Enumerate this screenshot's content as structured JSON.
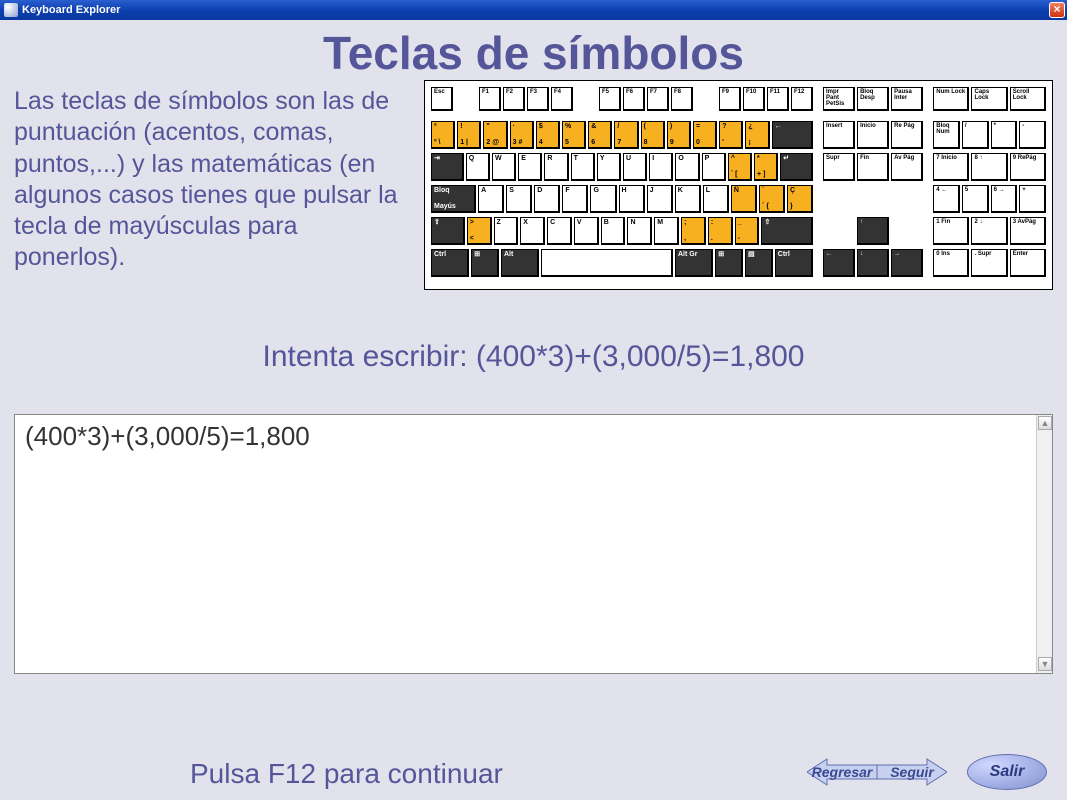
{
  "window": {
    "title": "Keyboard Explorer"
  },
  "page": {
    "heading": "Teclas de símbolos",
    "description": "Las teclas de símbolos son las de puntuación (acentos, comas, puntos,...) y las matemáticas (en algunos casos tienes que pulsar la tecla de mayúsculas para ponerlos).",
    "prompt": "Intenta escribir: (400*3)+(3,000/5)=1,800",
    "input_value": "(400*3)+(3,000/5)=1,800",
    "hint": "Pulsa F12 para continuar"
  },
  "buttons": {
    "back": "Regresar",
    "next": "Seguir",
    "exit": "Salir"
  },
  "keyboard": {
    "function_row": [
      "Esc",
      "F1",
      "F2",
      "F3",
      "F4",
      "F5",
      "F6",
      "F7",
      "F8",
      "F9",
      "F10",
      "F11",
      "F12"
    ],
    "indicators_top": [
      "Impr Pant PetSis",
      "Bloq Desp",
      "Pausa Inter"
    ],
    "leds": [
      "Num Lock",
      "Caps Lock",
      "Scroll Lock"
    ],
    "row1": [
      {
        "t": "ª",
        "b": "º \\",
        "y": true
      },
      {
        "t": "!",
        "b": "1 |",
        "y": true
      },
      {
        "t": "\"",
        "b": "2 @",
        "y": true
      },
      {
        "t": "·",
        "b": "3 #",
        "y": true
      },
      {
        "t": "$",
        "b": "4",
        "y": true
      },
      {
        "t": "%",
        "b": "5",
        "y": true
      },
      {
        "t": "&",
        "b": "6",
        "y": true
      },
      {
        "t": "/",
        "b": "7",
        "y": true
      },
      {
        "t": "(",
        "b": "8",
        "y": true
      },
      {
        "t": ")",
        "b": "9",
        "y": true
      },
      {
        "t": "=",
        "b": "0",
        "y": true
      },
      {
        "t": "?",
        "b": "'",
        "y": true
      },
      {
        "t": "¿",
        "b": "¡",
        "y": true
      },
      {
        "t": "←",
        "b": "",
        "dark": true,
        "wide": "wide2"
      }
    ],
    "row2": [
      {
        "t": "⇥",
        "b": "",
        "dark": true,
        "wide": "wide1"
      },
      {
        "t": "Q"
      },
      {
        "t": "W"
      },
      {
        "t": "E"
      },
      {
        "t": "R"
      },
      {
        "t": "T"
      },
      {
        "t": "Y"
      },
      {
        "t": "U"
      },
      {
        "t": "I"
      },
      {
        "t": "O"
      },
      {
        "t": "P"
      },
      {
        "t": "^",
        "b": "` [",
        "y": true
      },
      {
        "t": "*",
        "b": "+ ]",
        "y": true
      },
      {
        "t": "↵",
        "b": "",
        "dark": true,
        "wide": "wide1"
      }
    ],
    "row3": [
      {
        "t": "Bloq",
        "b": "Mayús",
        "dark": true,
        "wide": "wide2"
      },
      {
        "t": "A"
      },
      {
        "t": "S"
      },
      {
        "t": "D"
      },
      {
        "t": "F"
      },
      {
        "t": "G"
      },
      {
        "t": "H"
      },
      {
        "t": "J"
      },
      {
        "t": "K"
      },
      {
        "t": "L"
      },
      {
        "t": "Ñ",
        "y": true
      },
      {
        "t": "¨",
        "b": "´ {",
        "y": true
      },
      {
        "t": "Ç",
        "b": "}",
        "y": true
      }
    ],
    "row4": [
      {
        "t": "⇧",
        "b": "",
        "dark": true,
        "wide": "wide1"
      },
      {
        "t": ">",
        "b": "<",
        "y": true
      },
      {
        "t": "Z"
      },
      {
        "t": "X"
      },
      {
        "t": "C"
      },
      {
        "t": "V"
      },
      {
        "t": "B"
      },
      {
        "t": "N"
      },
      {
        "t": "M"
      },
      {
        "t": ";",
        "b": ",",
        "y": true
      },
      {
        "t": ":",
        "b": ".",
        "y": true
      },
      {
        "t": "_",
        "b": "-",
        "y": true
      },
      {
        "t": "⇧",
        "b": "",
        "dark": true,
        "wide": "wide25"
      }
    ],
    "row5": [
      {
        "t": "Ctrl",
        "dark": true,
        "wide": "wide1"
      },
      {
        "t": "⊞",
        "dark": true
      },
      {
        "t": "Alt",
        "dark": true,
        "wide": "wide1"
      },
      {
        "t": "",
        "space": true
      },
      {
        "t": "Alt Gr",
        "dark": true,
        "wide": "wide1"
      },
      {
        "t": "⊞",
        "dark": true
      },
      {
        "t": "▤",
        "dark": true
      },
      {
        "t": "Ctrl",
        "dark": true,
        "wide": "wide1"
      }
    ],
    "nav_top": [
      "Insert",
      "Inicio",
      "Re Pág"
    ],
    "nav_mid": [
      "Supr",
      "Fin",
      "Av Pág"
    ],
    "arrows": {
      "up": "↑",
      "left": "←",
      "down": "↓",
      "right": "→"
    },
    "numpad": [
      [
        "Bloq Num",
        "/",
        "*",
        "-"
      ],
      [
        "7 Inicio",
        "8 ↑",
        "9 RePág"
      ],
      [
        "4 ←",
        "5",
        "6 →",
        "+"
      ],
      [
        "1 Fin",
        "2 ↓",
        "3 AvPág"
      ],
      [
        "0 Ins",
        ". Supr",
        "Enter"
      ]
    ]
  }
}
